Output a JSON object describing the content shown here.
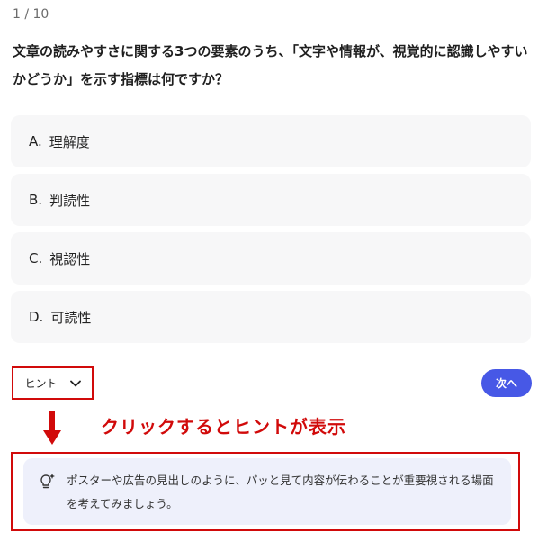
{
  "quiz": {
    "counter": "1 / 10",
    "question": "文章の読みやすさに関する3つの要素のうち、「文字や情報が、視覚的に認識しやすいかどうか」を示す指標は何ですか？",
    "options": [
      {
        "letter": "A.",
        "label": "理解度"
      },
      {
        "letter": "B.",
        "label": "判読性"
      },
      {
        "letter": "C.",
        "label": "視認性"
      },
      {
        "letter": "D.",
        "label": "可読性"
      }
    ],
    "hint_label": "ヒント",
    "next_label": "次へ",
    "hint_text": "ポスターや広告の見出しのように、パッと見て内容が伝わることが重要視される場面を考えてみましょう。"
  },
  "annotation": {
    "text": "クリックするとヒントが表示",
    "color": "#d10a0a"
  },
  "colors": {
    "accent": "#4758e6",
    "option_bg": "#f7f7f8",
    "hint_bg": "#eef0fb"
  },
  "icons": {
    "hint_toggle": "chevron-down-icon",
    "hint": "lightbulb-icon",
    "annotation_arrow": "arrow-down-icon"
  }
}
